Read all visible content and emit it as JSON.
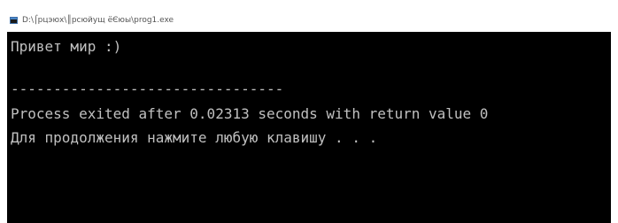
{
  "window": {
    "title": "D:\\⌠рцэюх\\║рсюйущ ёЄюы\\prog1.exe",
    "icon": "console-app-icon"
  },
  "console": {
    "lines": [
      "Привет мир :)",
      "",
      "--------------------------------",
      "Process exited after 0.02313 seconds with return value 0",
      "Для продолжения нажмите любую клавишу . . ."
    ]
  },
  "colors": {
    "console_background": "#000000",
    "console_text": "#c0c0c0",
    "titlebar_background": "#ffffff"
  }
}
